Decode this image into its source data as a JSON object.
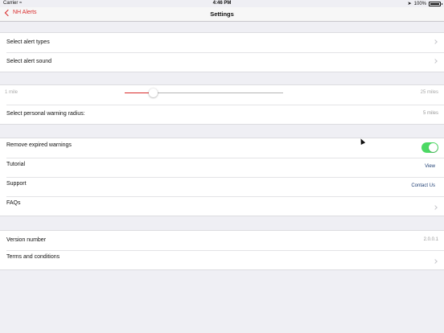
{
  "status_bar": {
    "carrier": "Carrier",
    "time": "4:46 PM",
    "battery": "100%"
  },
  "nav": {
    "back_label": "NH Alerts",
    "title": "Settings"
  },
  "alerts_group": {
    "alert_types_label": "Select alert types",
    "alert_sound_label": "Select alert sound"
  },
  "radius_group": {
    "slider_min": "1 mile",
    "slider_max": "25 miles",
    "slider_fraction": 0.18,
    "radius_label": "Select personal warning radius:",
    "radius_value": "5 miles"
  },
  "options_group": {
    "remove_expired_label": "Remove expired warnings",
    "remove_expired_on": true,
    "tutorial_label": "Tutorial",
    "tutorial_action": "View",
    "support_label": "Support",
    "support_action": "Contact Us",
    "faqs_label": "FAQs"
  },
  "info_group": {
    "version_label": "Version number",
    "version_value": "2.0.0.1",
    "terms_label": "Terms and conditions"
  },
  "colors": {
    "accent": "#d92b2b",
    "toggle_on": "#4cd964",
    "link": "#1f3f74",
    "background": "#efeff4"
  }
}
